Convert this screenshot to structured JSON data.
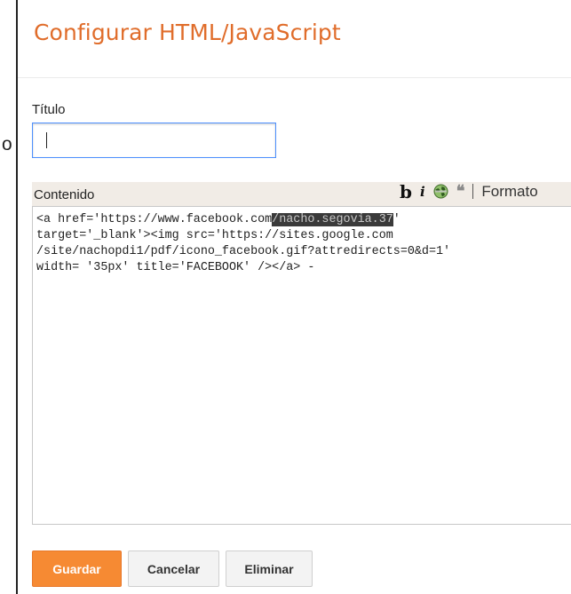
{
  "dialog": {
    "title": "Configurar HTML/JavaScript"
  },
  "stray_char": "o",
  "form": {
    "titulo_label": "Título",
    "titulo_value": "",
    "contenido_label": "Contenido",
    "contenido_code": {
      "before": "<a href='https://www.facebook.com",
      "redacted": "/nacho.segovia.37",
      "after": "'\ntarget='_blank'><img src='https://sites.google.com\n/site/nachopdi1/pdf/icono_facebook.gif?attredirects=0&d=1'\nwidth= '35px' title='FACEBOOK' /></a> -"
    }
  },
  "toolbar": {
    "bold_label": "b",
    "italic_label": "i",
    "link_icon": "link-globe-icon",
    "quote_label": "❝",
    "quote_icon": "quote-icon",
    "format_label": "Formato"
  },
  "buttons": {
    "save_label": "Guardar",
    "cancel_label": "Cancelar",
    "delete_label": "Eliminar"
  },
  "colors": {
    "title": "#e06d2b",
    "primary_button": "#f68a33",
    "input_focus_border": "#4d90fe",
    "editor_bar": "#f1ece6"
  }
}
